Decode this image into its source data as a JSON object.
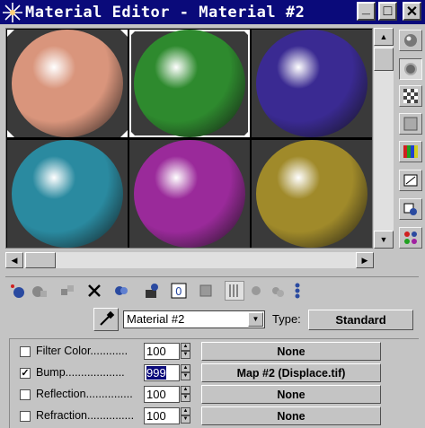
{
  "window": {
    "title": "Material Editor - Material #2",
    "minimize": "_",
    "maximize": "□",
    "close": "✕"
  },
  "slots": [
    {
      "name": "slot-1",
      "color": "#d9957c",
      "selected": false,
      "framed": true
    },
    {
      "name": "slot-2",
      "color": "#2e8a2e",
      "selected": true,
      "framed": true
    },
    {
      "name": "slot-3",
      "color": "#3a2a92",
      "selected": false,
      "framed": false
    },
    {
      "name": "slot-4",
      "color": "#2a8aa0",
      "selected": false,
      "framed": false
    },
    {
      "name": "slot-5",
      "color": "#9a2a9a",
      "selected": false,
      "framed": false
    },
    {
      "name": "slot-6",
      "color": "#a08a2a",
      "selected": false,
      "framed": false
    }
  ],
  "right_toolbar": [
    {
      "icon": "sample-type-sphere-icon"
    },
    {
      "icon": "backlight-icon"
    },
    {
      "icon": "background-checker-icon"
    },
    {
      "icon": "sample-uv-tiling-icon"
    },
    {
      "icon": "video-color-check-icon"
    },
    {
      "icon": "make-preview-icon"
    },
    {
      "icon": "options-icon"
    },
    {
      "icon": "select-by-material-icon"
    }
  ],
  "material": {
    "name": "Material #2",
    "type_label": "Type:",
    "type_value": "Standard"
  },
  "maps": [
    {
      "label": "Filter Color............",
      "checked": false,
      "amount": "100",
      "map": "None",
      "selected": false
    },
    {
      "label": "Bump...................",
      "checked": true,
      "amount": "999",
      "map": "Map #2 (Displace.tif)",
      "selected": true
    },
    {
      "label": "Reflection...............",
      "checked": false,
      "amount": "100",
      "map": "None",
      "selected": false
    },
    {
      "label": "Refraction...............",
      "checked": false,
      "amount": "100",
      "map": "None",
      "selected": false
    }
  ]
}
